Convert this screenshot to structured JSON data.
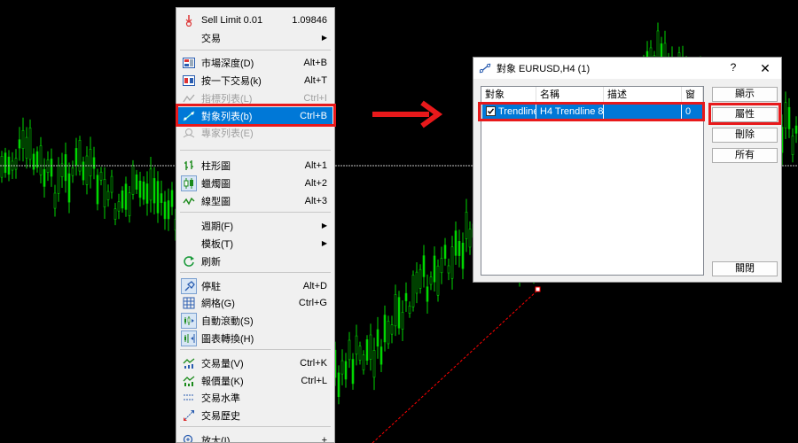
{
  "chart": {
    "colors": {
      "background": "#000000",
      "candle": "#00d600",
      "trendline": "#ff0000",
      "crosshair": "#c0c0c0"
    }
  },
  "menu": {
    "sell_limit": {
      "label": "Sell Limit 0.01",
      "value": "1.09846",
      "icon": "sell-limit-icon"
    },
    "trade": {
      "label": "交易"
    },
    "market_depth": {
      "label": "市場深度(D)",
      "shortcut": "Alt+B"
    },
    "one_click": {
      "label": "按一下交易(k)",
      "shortcut": "Alt+T"
    },
    "indicators_list": {
      "label": "指標列表(L)",
      "shortcut": "Ctrl+I"
    },
    "objects_list": {
      "label": "對象列表(b)",
      "shortcut": "Ctrl+B"
    },
    "experts_list": {
      "label": "專家列表(E)"
    },
    "bar_chart": {
      "label": "柱形圖",
      "shortcut": "Alt+1"
    },
    "candlesticks": {
      "label": "蠟燭圖",
      "shortcut": "Alt+2"
    },
    "line_chart": {
      "label": "線型圖",
      "shortcut": "Alt+3"
    },
    "periods": {
      "label": "週期(F)"
    },
    "template": {
      "label": "模板(T)"
    },
    "refresh": {
      "label": "刷新"
    },
    "dock": {
      "label": "停駐",
      "shortcut": "Alt+D"
    },
    "grid": {
      "label": "網格(G)",
      "shortcut": "Ctrl+G"
    },
    "auto_scroll": {
      "label": "自動滾動(S)"
    },
    "chart_shift": {
      "label": "圖表轉換(H)"
    },
    "volumes": {
      "label": "交易量(V)",
      "shortcut": "Ctrl+K"
    },
    "tick_volumes": {
      "label": "報價量(K)",
      "shortcut": "Ctrl+L"
    },
    "trade_levels": {
      "label": "交易水準"
    },
    "trade_history": {
      "label": "交易歷史"
    },
    "zoom_in": {
      "label": "放大(I)",
      "shortcut": "+"
    },
    "highlight_color": "#0078d7",
    "annotation_color": "#e8191b"
  },
  "dialog": {
    "title": "對象 EURUSD,H4 (1)",
    "help": "?",
    "close": "✕",
    "columns": [
      "對象",
      "名稱",
      "描述",
      "窗"
    ],
    "rows": [
      {
        "checked": true,
        "object": "Trendline",
        "name": "H4 Trendline 8...",
        "description": "",
        "window": "0"
      }
    ],
    "buttons": {
      "show": "顯示",
      "properties": "屬性",
      "delete": "刪除",
      "all": "所有",
      "close": "關閉"
    }
  }
}
